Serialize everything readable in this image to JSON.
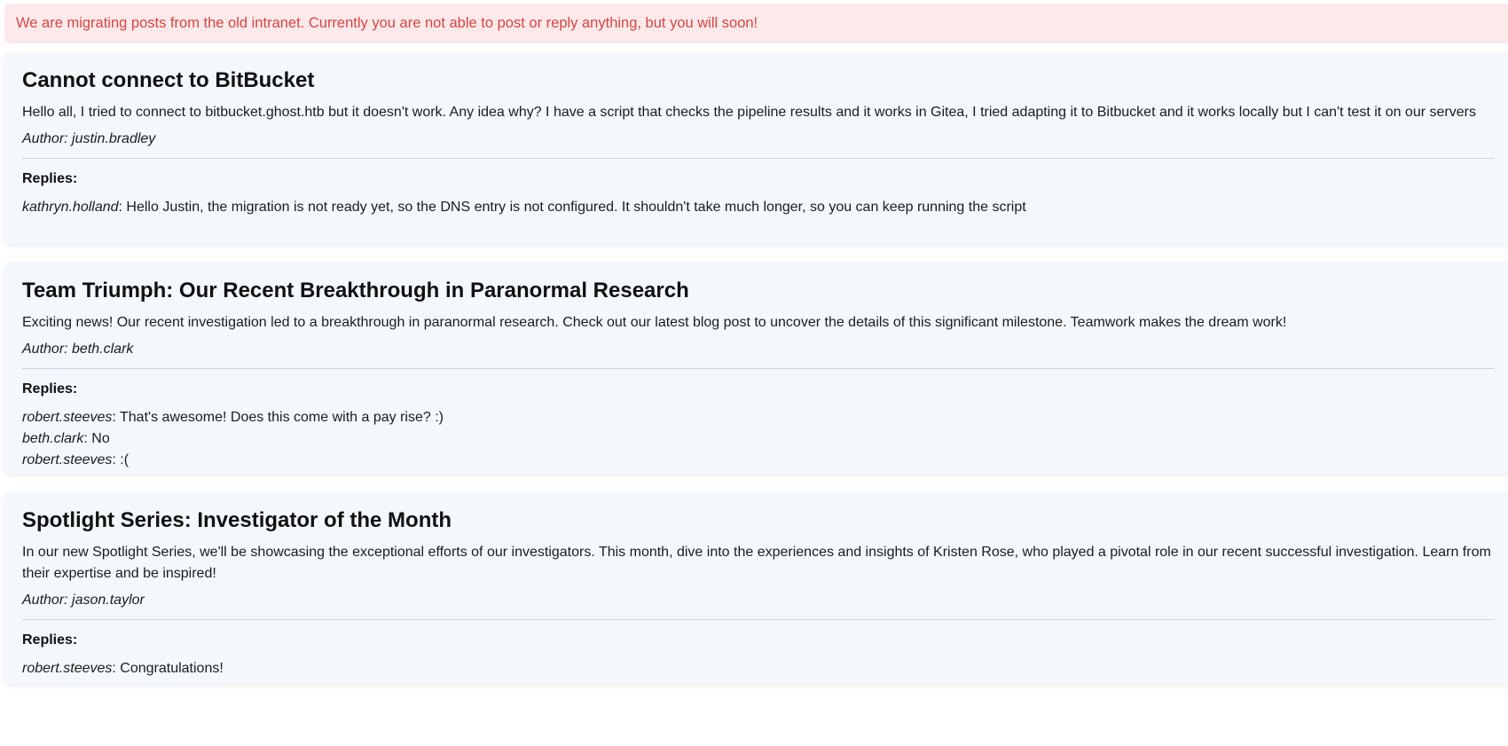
{
  "alert": {
    "text": "We are migrating posts from the old intranet. Currently you are not able to post or reply anything, but you will soon!",
    "color": "#d64545",
    "background": "#fde9e9"
  },
  "posts": [
    {
      "title": "Cannot connect to BitBucket",
      "body": "Hello all, I tried to connect to bitbucket.ghost.htb but it doesn't work. Any idea why? I have a script that checks the pipeline results and it works in Gitea, I tried adapting it to Bitbucket and it works locally but I can't test it on our servers",
      "author": "Author: justin.bradley",
      "replies_label": "Replies:",
      "replies": [
        {
          "user": "kathryn.holland",
          "sep": ": ",
          "text": "Hello Justin, the migration is not ready yet, so the DNS entry is not configured. It shouldn't take much longer, so you can keep running the script"
        }
      ]
    },
    {
      "title": "Team Triumph: Our Recent Breakthrough in Paranormal Research",
      "body": "Exciting news! Our recent investigation led to a breakthrough in paranormal research. Check out our latest blog post to uncover the details of this significant milestone. Teamwork makes the dream work!",
      "author": "Author: beth.clark",
      "replies_label": "Replies:",
      "replies": [
        {
          "user": "robert.steeves",
          "sep": ": ",
          "text": "That's awesome! Does this come with a pay rise? :)"
        },
        {
          "user": "beth.clark",
          "sep": ": ",
          "text": "No"
        },
        {
          "user": "robert.steeves",
          "sep": ": ",
          "text": ":("
        }
      ]
    },
    {
      "title": "Spotlight Series: Investigator of the Month",
      "body": "In our new Spotlight Series, we'll be showcasing the exceptional efforts of our investigators. This month, dive into the experiences and insights of Kristen Rose, who played a pivotal role in our recent successful investigation. Learn from their expertise and be inspired!",
      "author": "Author: jason.taylor",
      "replies_label": "Replies:",
      "replies": [
        {
          "user": "robert.steeves",
          "sep": ": ",
          "text": "Congratulations!"
        }
      ]
    }
  ]
}
